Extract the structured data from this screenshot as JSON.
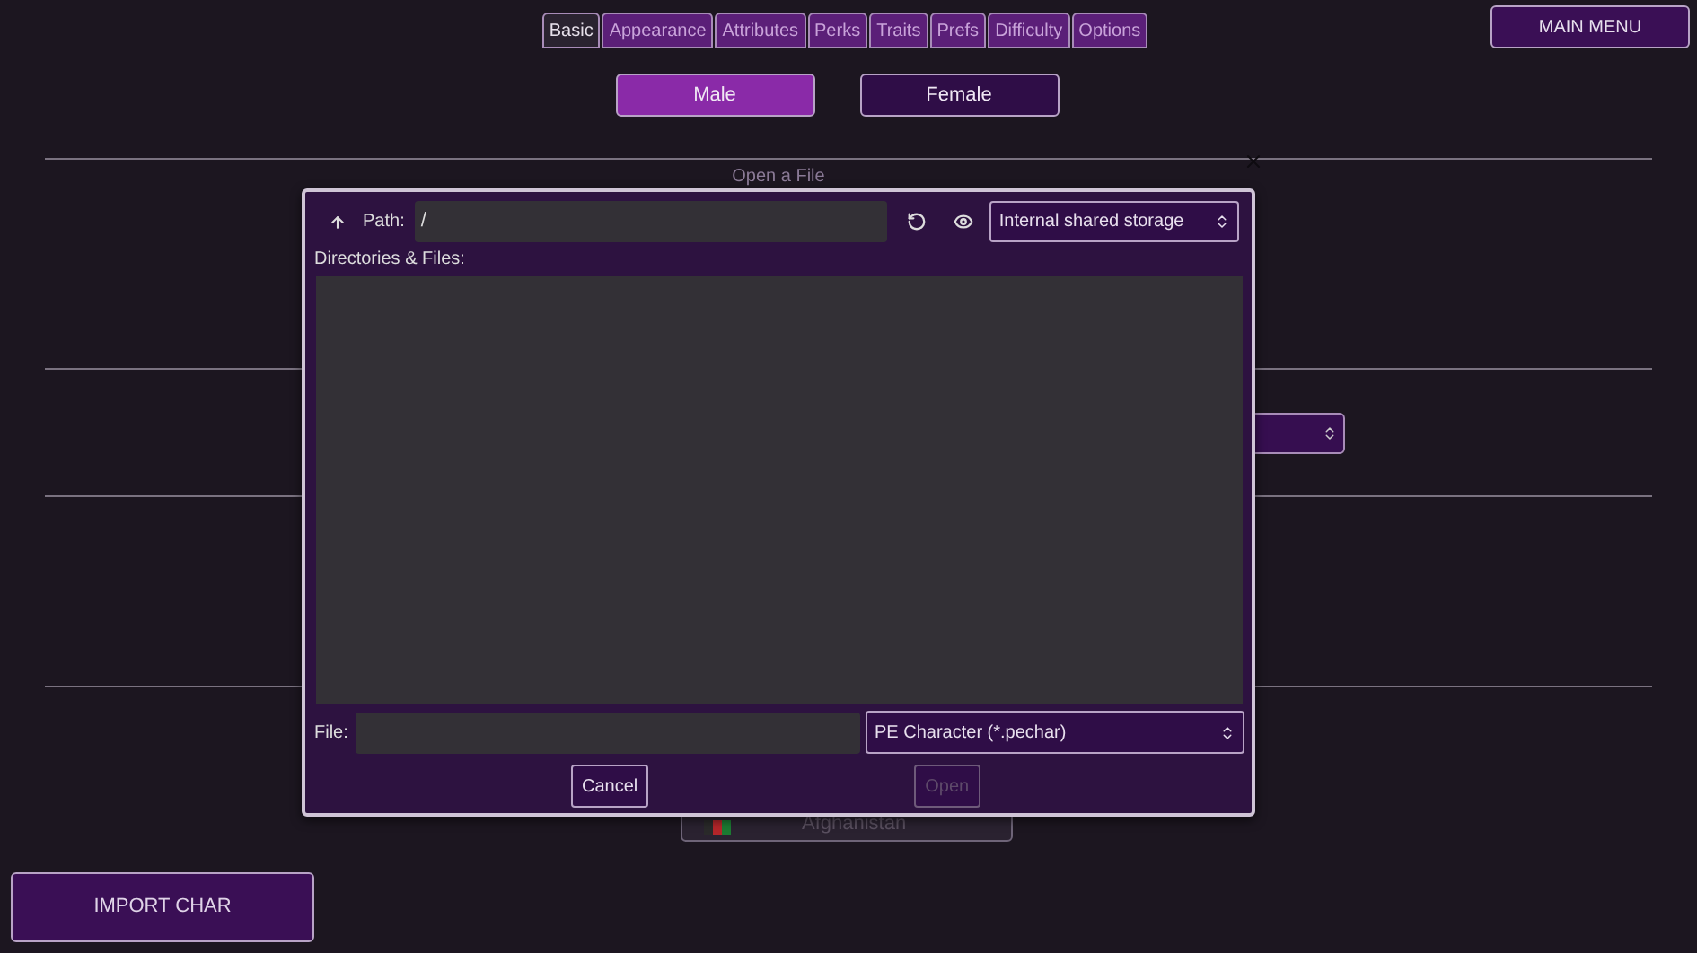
{
  "tabs": [
    {
      "label": "Basic",
      "selected": true
    },
    {
      "label": "Appearance",
      "selected": false
    },
    {
      "label": "Attributes",
      "selected": false
    },
    {
      "label": "Perks",
      "selected": false
    },
    {
      "label": "Traits",
      "selected": false
    },
    {
      "label": "Prefs",
      "selected": false
    },
    {
      "label": "Difficulty",
      "selected": false
    },
    {
      "label": "Options",
      "selected": false
    }
  ],
  "main_menu": "MAIN MENU",
  "gender": [
    {
      "label": "Male",
      "selected": true
    },
    {
      "label": "Female",
      "selected": false
    }
  ],
  "country_button": {
    "label": "Afghanistan"
  },
  "import_button": "IMPORT CHAR",
  "dialog": {
    "title": "Open a File",
    "path_label": "Path:",
    "path_value": "/",
    "drive_select": "Internal shared storage",
    "list_label": "Directories & Files:",
    "file_label": "File:",
    "filter_select": "PE Character (*.pechar)",
    "buttons": [
      {
        "label": "Cancel",
        "disabled": false
      },
      {
        "label": "Open",
        "disabled": true
      }
    ]
  }
}
